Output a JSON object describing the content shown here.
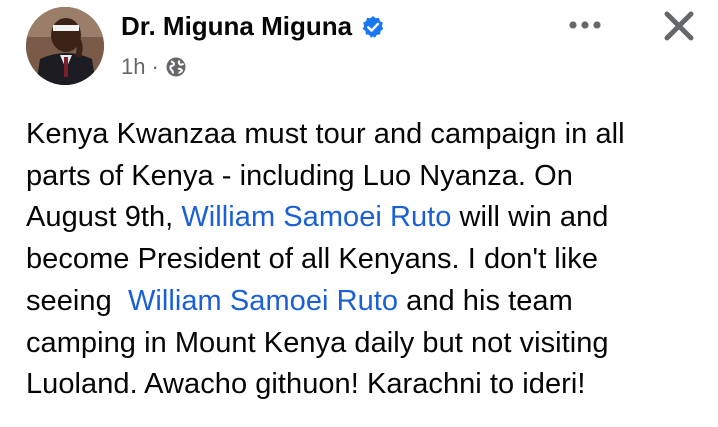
{
  "post": {
    "author": "Dr. Miguna Miguna",
    "time": "1h",
    "separator": "·",
    "privacy_icon": "globe-icon",
    "verified_icon": "verified-badge-icon",
    "more_icon": "more-options-icon",
    "close_icon": "close-icon",
    "lines": [
      {
        "parts": [
          {
            "text": "Kenya Kwanzaa must tour and campaign in all",
            "link": false
          }
        ]
      },
      {
        "parts": [
          {
            "text": "parts of Kenya - including Luo Nyanza. On",
            "link": false
          }
        ]
      },
      {
        "parts": [
          {
            "text": "August 9th, ",
            "link": false
          },
          {
            "text": "William Samoei Ruto",
            "link": true
          },
          {
            "text": " will win and",
            "link": false
          }
        ]
      },
      {
        "parts": [
          {
            "text": "become President of all Kenyans. I don't like",
            "link": false
          }
        ]
      },
      {
        "parts": [
          {
            "text": "seeing  ",
            "link": false
          },
          {
            "text": "William Samoei Ruto",
            "link": true
          },
          {
            "text": " and his team",
            "link": false
          }
        ]
      },
      {
        "parts": [
          {
            "text": "camping in Mount Kenya daily but not visiting",
            "link": false
          }
        ]
      },
      {
        "parts": [
          {
            "text": "Luoland. Awacho githuon! Karachni to ideri!",
            "link": false
          }
        ]
      }
    ]
  },
  "colors": {
    "text": "#050505",
    "secondary": "#65676b",
    "link": "#1b5fd6",
    "verified": "#1877f2"
  }
}
